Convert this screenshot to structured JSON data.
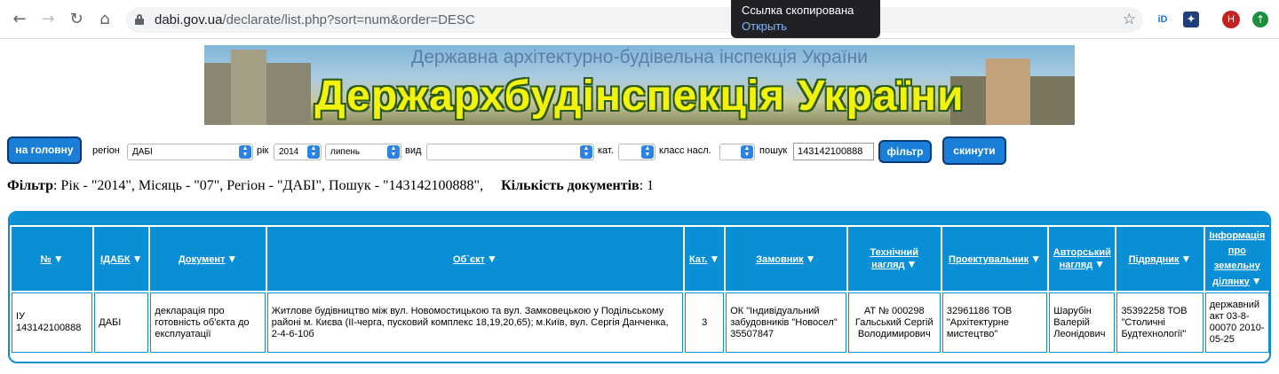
{
  "browser": {
    "url_host": "dabi.gov.ua",
    "url_path": "/declarate/list.php?sort=num&order=DESC",
    "toast_title": "Ссылка скопирована",
    "toast_action": "Открыть",
    "profile_initial": "H",
    "ext1_label": "iD",
    "icons": [
      "back-arrow-icon",
      "forward-arrow-icon",
      "reload-icon",
      "home-icon",
      "lock-icon",
      "star-icon",
      "update-icon"
    ]
  },
  "banner": {
    "subtitle": "Державна архітектурно-будівельна інспекція України",
    "title": "Держархбудінспекція України"
  },
  "filters": {
    "home_button": "на головну",
    "region_label": "регіон",
    "region_value": "ДАБІ",
    "year_label": "рік",
    "year_value": "2014",
    "month_value": "липень",
    "type_label": "вид",
    "type_value": "",
    "cat_label": "кат.",
    "cat_value": "",
    "class_label": "класс насл.",
    "class_value": "",
    "search_label": "пошук",
    "search_value": "143142100888",
    "filter_button": "фільтр",
    "reset_button": "скинути"
  },
  "summary": {
    "filter_label": "Фільтр",
    "filter_text": ": Рік - \"2014\", Місяць - \"07\", Регіон - \"ДАБІ\", Пошук - \"143142100888\",",
    "count_label": "Кількість документів",
    "count_value": ": 1"
  },
  "table": {
    "headers": [
      "№",
      "ІДАБК",
      "Документ",
      "Об`єкт",
      "Кат.",
      "Замовник",
      "Технічний нагляд",
      "Проектувальник",
      "Авторський нагляд",
      "Підрядник",
      "Інформація про земельну ділянку"
    ],
    "rows": [
      [
        "ІУ 143142100888",
        "ДАБІ",
        "декларація про готовність об'єкта до експлуатації",
        "Житлове будівництво між вул. Новомостицькою та вул. Замковецькою у Подільському районі м. Києва (ІІ-черга, пусковий комплекс 18,19,20,65); м.Київ, вул. Сергія Данченка, 2-4-6-10б",
        "3",
        "ОК \"Індивідуальний забудовників \"Новосел\" 35507847",
        "АТ № 000298 Гальський Сергій Володимирович",
        "32961186 ТОВ \"Архітектурне мистецтво\"",
        "Шарубін Валерій Леонідович",
        "35392258 ТОВ \"Столичні Будтехнології\"",
        "державний акт 03-8-00070 2010-05-25"
      ]
    ]
  }
}
